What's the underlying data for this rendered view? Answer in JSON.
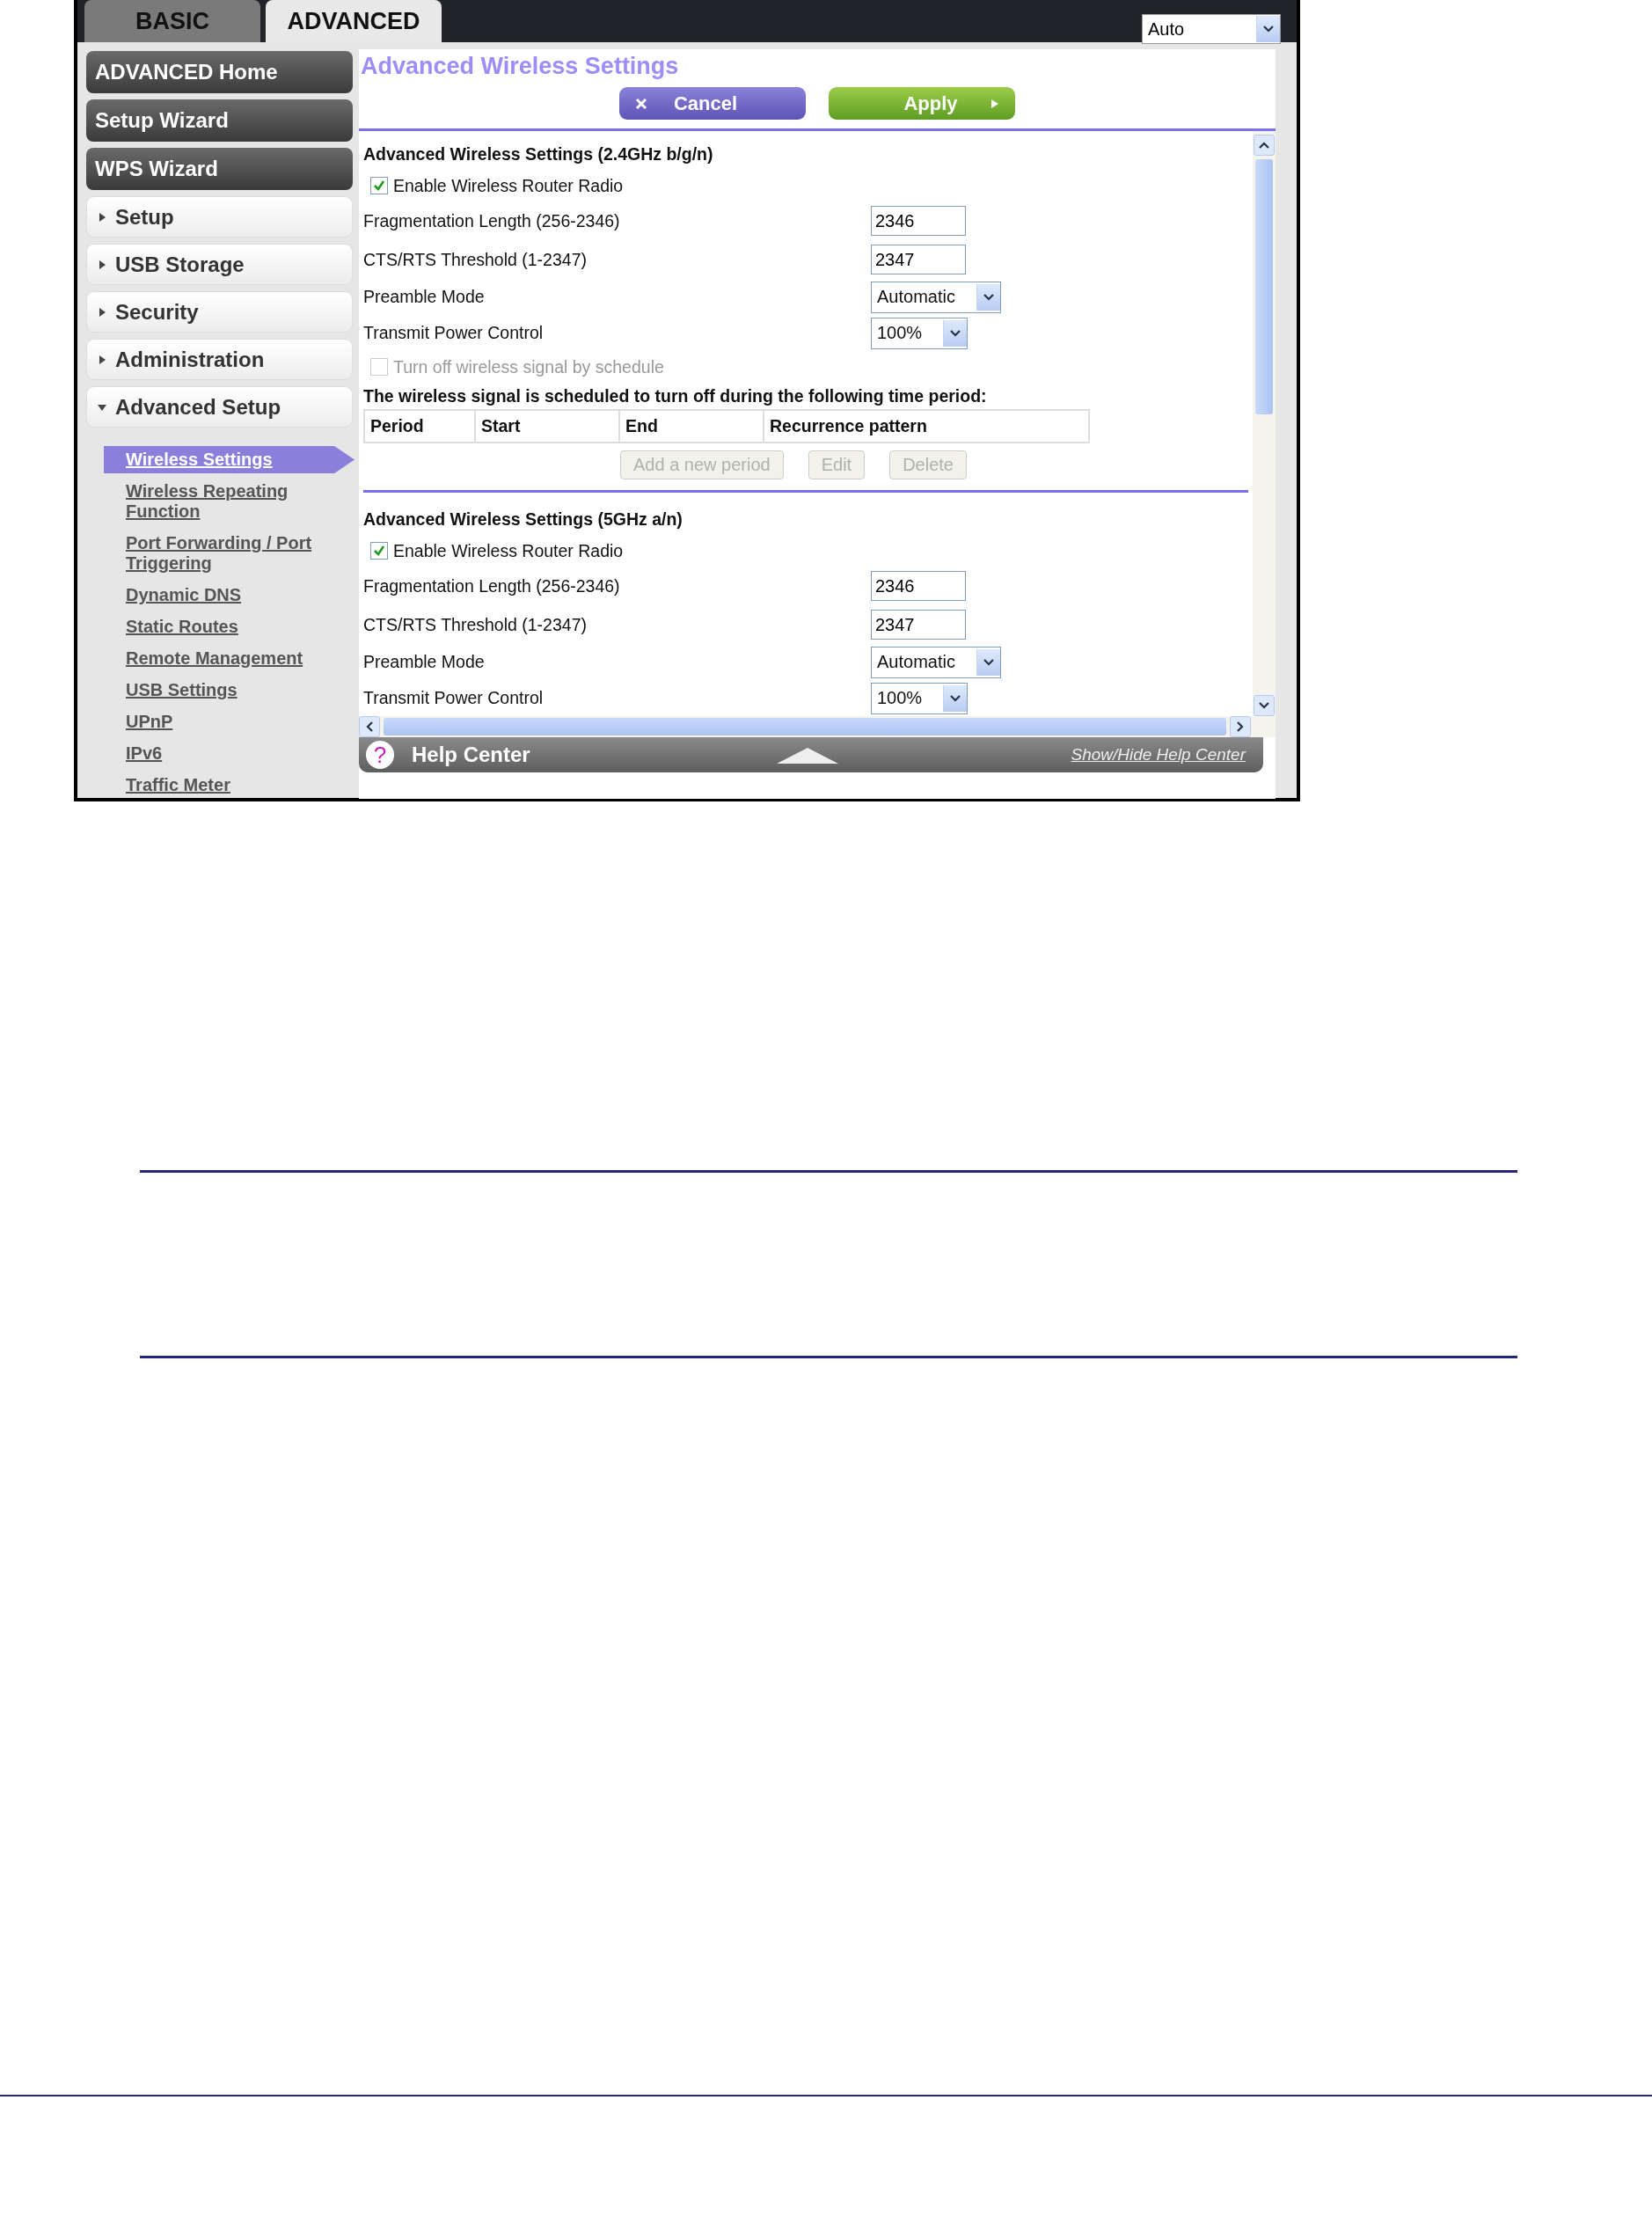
{
  "tabs": [
    {
      "label": "BASIC",
      "selected": false
    },
    {
      "label": "ADVANCED",
      "selected": true
    }
  ],
  "language_select": {
    "value": "Auto"
  },
  "sidebar": {
    "main_buttons": [
      "ADVANCED Home",
      "Setup Wizard",
      "WPS Wizard"
    ],
    "sections": [
      {
        "label": "Setup",
        "expanded": false
      },
      {
        "label": "USB Storage",
        "expanded": false
      },
      {
        "label": "Security",
        "expanded": false
      },
      {
        "label": "Administration",
        "expanded": false
      },
      {
        "label": "Advanced Setup",
        "expanded": true,
        "children": [
          {
            "label": "Wireless Settings",
            "selected": true
          },
          {
            "label": "Wireless Repeating Function",
            "selected": false
          },
          {
            "label": "Port Forwarding / Port Triggering",
            "selected": false
          },
          {
            "label": "Dynamic DNS",
            "selected": false
          },
          {
            "label": "Static Routes",
            "selected": false
          },
          {
            "label": "Remote Management",
            "selected": false
          },
          {
            "label": "USB Settings",
            "selected": false
          },
          {
            "label": "UPnP",
            "selected": false
          },
          {
            "label": "IPv6",
            "selected": false
          },
          {
            "label": "Traffic Meter",
            "selected": false
          }
        ]
      }
    ]
  },
  "page": {
    "title": "Advanced Wireless Settings",
    "buttons": [
      {
        "label": "Cancel",
        "kind": "cancel"
      },
      {
        "label": "Apply",
        "kind": "apply"
      }
    ]
  },
  "sections": [
    {
      "heading": "Advanced Wireless Settings (2.4GHz b/g/n)",
      "enable_radio": {
        "label": "Enable Wireless Router Radio",
        "checked": true
      },
      "fields": [
        {
          "label": "Fragmentation Length (256-2346)",
          "kind": "text",
          "value": "2346"
        },
        {
          "label": "CTS/RTS Threshold (1-2347)",
          "kind": "text",
          "value": "2347"
        },
        {
          "label": "Preamble Mode",
          "kind": "select",
          "value": "Automatic"
        },
        {
          "label": "Transmit Power Control",
          "kind": "select",
          "value": "100%"
        }
      ],
      "schedule": {
        "checkbox": {
          "label": "Turn off wireless signal by schedule",
          "checked": false,
          "disabled": true
        },
        "note": "The wireless signal is scheduled to turn off during the following time period:",
        "columns": [
          "Period",
          "Start",
          "End",
          "Recurrence pattern"
        ],
        "buttons": [
          {
            "label": "Add a new period",
            "disabled": true
          },
          {
            "label": "Edit",
            "disabled": true
          },
          {
            "label": "Delete",
            "disabled": true
          }
        ]
      }
    },
    {
      "heading": "Advanced Wireless Settings (5GHz a/n)",
      "enable_radio": {
        "label": "Enable Wireless Router Radio",
        "checked": true
      },
      "fields": [
        {
          "label": "Fragmentation Length (256-2346)",
          "kind": "text",
          "value": "2346"
        },
        {
          "label": "CTS/RTS Threshold (1-2347)",
          "kind": "text",
          "value": "2347"
        },
        {
          "label": "Preamble Mode",
          "kind": "select",
          "value": "Automatic"
        },
        {
          "label": "Transmit Power Control",
          "kind": "select",
          "value": "100%"
        }
      ]
    }
  ],
  "help_center": {
    "icon": "?",
    "title": "Help Center",
    "link": "Show/Hide Help Center"
  }
}
